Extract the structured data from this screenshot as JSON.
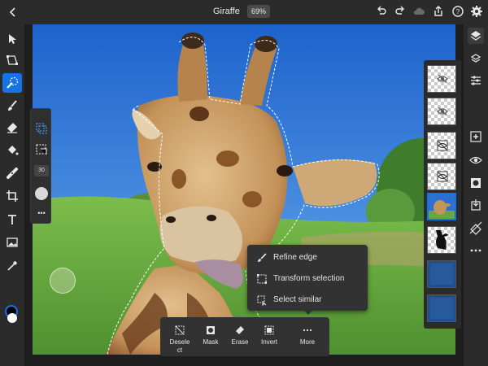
{
  "topbar": {
    "title": "Giraffe",
    "zoom": "69%",
    "icons": [
      "back-chevron-icon",
      "undo-icon",
      "redo-icon",
      "cloud-icon",
      "share-icon",
      "help-icon",
      "settings-gear-icon"
    ]
  },
  "left_toolbar": {
    "tools": [
      "move-tool",
      "transform-tool",
      "select-subject-brush-tool",
      "brush-tool",
      "eraser-tool",
      "fill-tool",
      "healing-tool",
      "crop-tool",
      "text-tool",
      "image-tool",
      "eyedropper-tool"
    ],
    "active_tool": "select-subject-brush-tool"
  },
  "tool_options": {
    "brush_size": "30",
    "more_label": "•••"
  },
  "right_toolbar": {
    "icons": [
      "layers-icon",
      "layer-stack-icon",
      "adjustments-icon",
      "add-layer-icon",
      "visibility-icon",
      "mask-icon",
      "import-icon",
      "clear-layer-icon",
      "more-icon"
    ]
  },
  "layers": {
    "count": 8,
    "selected_index": 4
  },
  "context_menu": {
    "items": [
      {
        "label": "Refine edge",
        "icon": "refine-edge-brush-icon"
      },
      {
        "label": "Transform selection",
        "icon": "transform-selection-icon"
      },
      {
        "label": "Select similar",
        "icon": "select-similar-icon"
      }
    ]
  },
  "bottom_bar": {
    "buttons": [
      {
        "label": "Deselect",
        "icon": "deselect-icon"
      },
      {
        "label": "Mask",
        "icon": "mask-icon"
      },
      {
        "label": "Erase",
        "icon": "erase-icon"
      },
      {
        "label": "Invert",
        "icon": "invert-icon"
      },
      {
        "label": "More",
        "icon": "more-dots-icon"
      }
    ]
  },
  "colors": {
    "accent": "#1473e6",
    "foreground_swatch": "#000000",
    "background_swatch": "#ffffff"
  }
}
